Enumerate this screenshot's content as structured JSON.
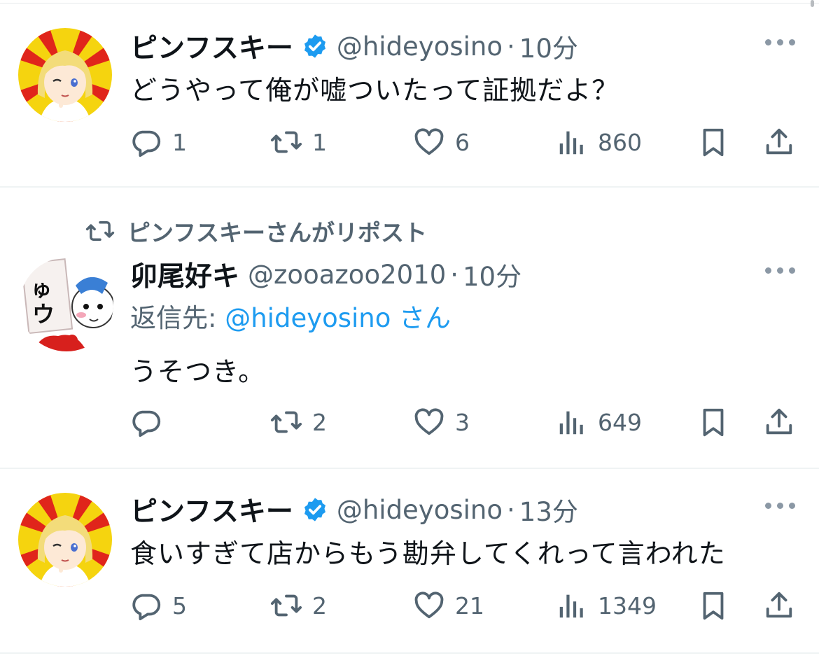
{
  "tweets": [
    {
      "name": "ピンフスキー",
      "handle": "@hideyosino",
      "time": "10分",
      "text": "どうやって俺が嘘ついたって証拠だよ？",
      "replies": "1",
      "reposts": "1",
      "likes": "6",
      "views": "860",
      "verified": true
    },
    {
      "repost_note": "ピンフスキーさんがリポスト",
      "name": "卯尾好キ",
      "handle": "@zooazoo2010",
      "time": "10分",
      "reply_label": "返信先:",
      "reply_target": "@hideyosino",
      "reply_suffix": "さん",
      "text": "うそつき。",
      "replies": "",
      "reposts": "2",
      "likes": "3",
      "views": "649",
      "verified": false
    },
    {
      "name": "ピンフスキー",
      "handle": "@hideyosino",
      "time": "13分",
      "text": "食いすぎて店からもう勘弁してくれって言われた",
      "replies": "5",
      "reposts": "2",
      "likes": "21",
      "views": "1349",
      "verified": true
    }
  ],
  "separator": "·",
  "colors": {
    "text": "#0f1419",
    "secondary": "#536471",
    "link": "#1d9bf0",
    "verified": "#1d9bf0",
    "divider": "#eff3f4"
  },
  "icons": [
    "reply-icon",
    "repost-icon",
    "like-icon",
    "views-icon",
    "bookmark-icon",
    "share-icon",
    "more-icon",
    "verified-badge-icon"
  ]
}
